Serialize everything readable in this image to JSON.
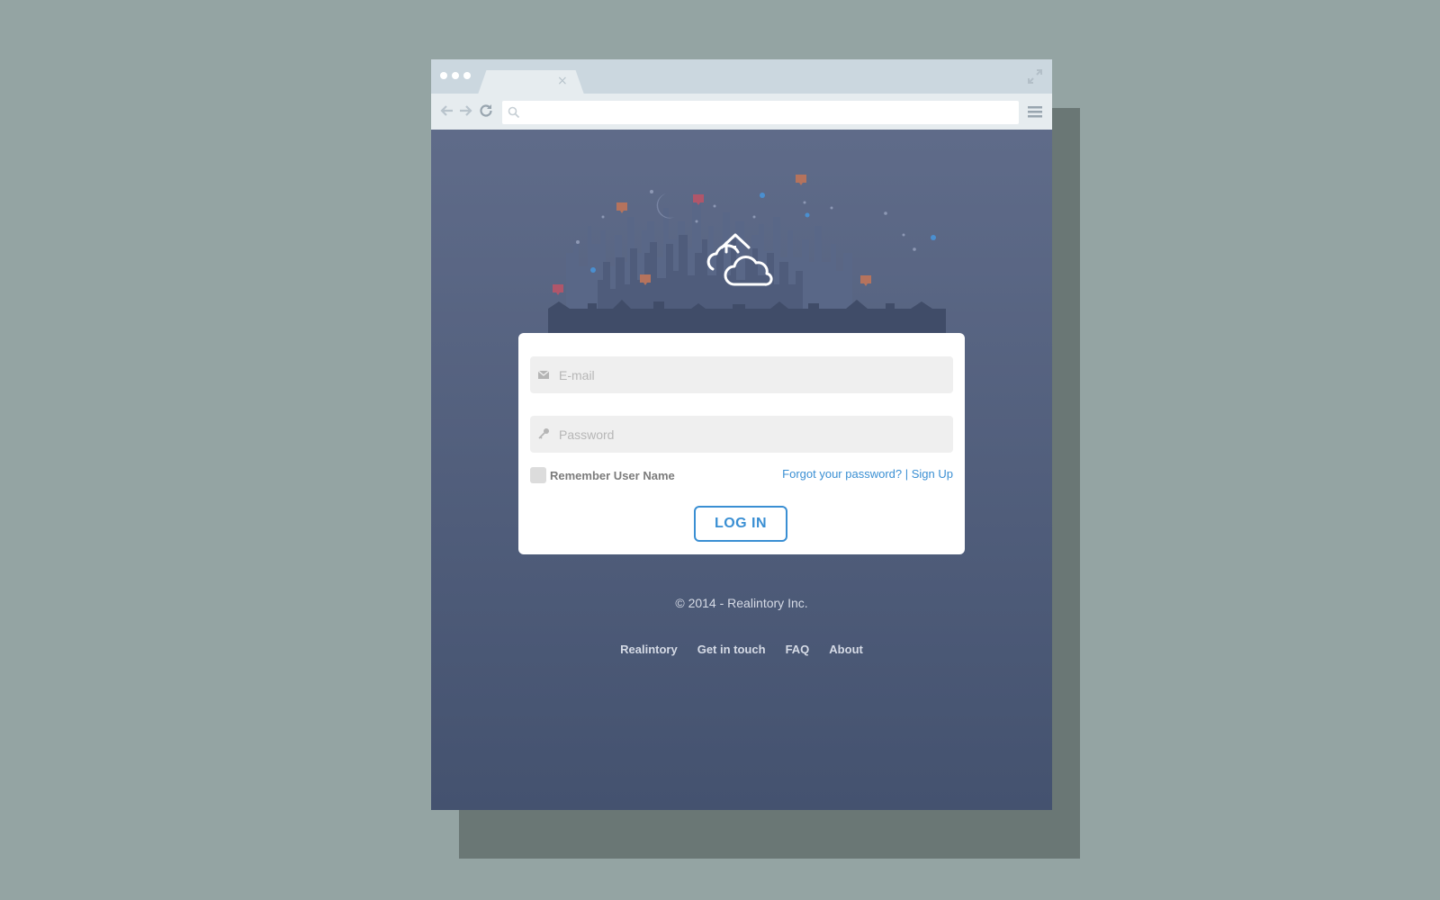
{
  "browser": {
    "tab_close": "×",
    "url_value": "",
    "icons": {
      "back": "arrow-left-icon",
      "forward": "arrow-right-icon",
      "reload": "reload-icon",
      "search": "search-icon",
      "menu": "hamburger-menu-icon",
      "expand": "expand-icon"
    }
  },
  "hero": {
    "logo_icon": "house-cloud-icon",
    "illustration": "night-city-skyline"
  },
  "login": {
    "email_placeholder": "E-mail",
    "email_value": "",
    "password_placeholder": "Password",
    "password_value": "",
    "remember_label": "Remember User Name",
    "remember_checked": false,
    "forgot_label": "Forgot your password?",
    "separator": "|",
    "signup_label": "Sign Up",
    "login_button": "LOG IN"
  },
  "footer": {
    "copyright": "© 2014 - Realintory Inc.",
    "links": [
      "Realintory",
      "Get in touch",
      "FAQ",
      "About"
    ]
  },
  "colors": {
    "page_bg": "#94a4a3",
    "accent": "#3a8fd3",
    "content_bg_top": "#626e8c",
    "content_bg_bottom": "#44526f"
  }
}
